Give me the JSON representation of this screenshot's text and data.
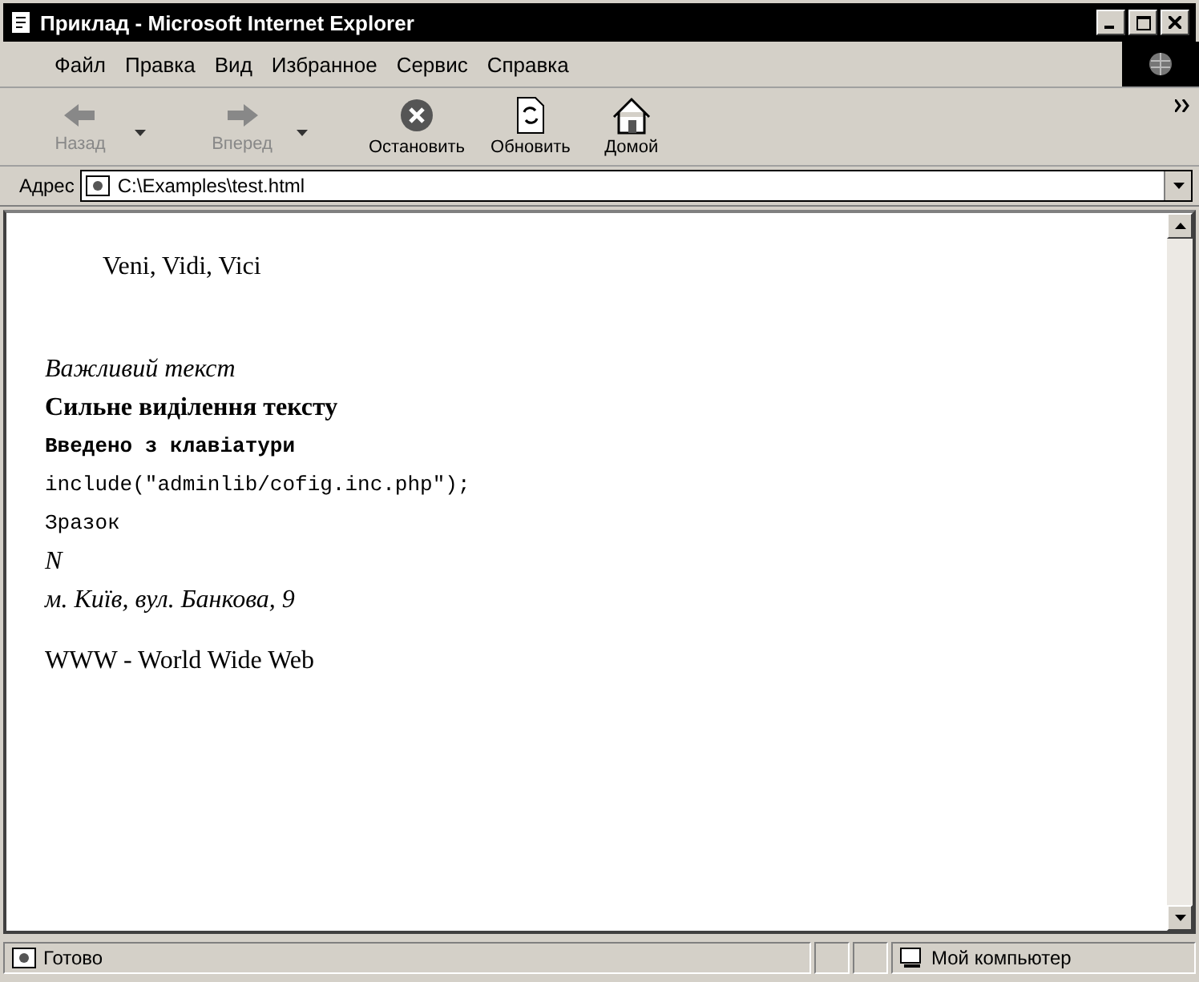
{
  "window": {
    "title": "Приклад - Microsoft Internet Explorer"
  },
  "menu": [
    "Файл",
    "Правка",
    "Вид",
    "Избранное",
    "Сервис",
    "Справка"
  ],
  "toolbar": [
    {
      "label": "Назад",
      "kind": "back",
      "disabled": true,
      "dropdown": true
    },
    {
      "label": "Вперед",
      "kind": "forward",
      "disabled": true,
      "dropdown": true
    },
    {
      "label": "Остановить",
      "kind": "stop",
      "disabled": false,
      "dropdown": false
    },
    {
      "label": "Обновить",
      "kind": "refresh",
      "disabled": false,
      "dropdown": false
    },
    {
      "label": "Домой",
      "kind": "home",
      "disabled": false,
      "dropdown": false
    }
  ],
  "address": {
    "label": "Адрес",
    "value": "C:\\Examples\\test.html"
  },
  "content": [
    {
      "kind": "indent",
      "text": "Veni, Vidi, Vici"
    },
    {
      "kind": "gap"
    },
    {
      "kind": "em",
      "text": "Важливий текст"
    },
    {
      "kind": "strong",
      "text": "Сильне виділення тексту"
    },
    {
      "kind": "kbd",
      "text": "Введено з клавіатури"
    },
    {
      "kind": "code",
      "text": "include(\"adminlib/cofig.inc.php\");"
    },
    {
      "kind": "samp",
      "text": "Зразок"
    },
    {
      "kind": "var",
      "text": "N"
    },
    {
      "kind": "address",
      "text": "м. Київ, вул. Банкова, 9"
    },
    {
      "kind": "abbr",
      "text": "WWW - World Wide Web"
    }
  ],
  "status_bar": {
    "text": "Готово",
    "zone": "Мой компьютер"
  }
}
